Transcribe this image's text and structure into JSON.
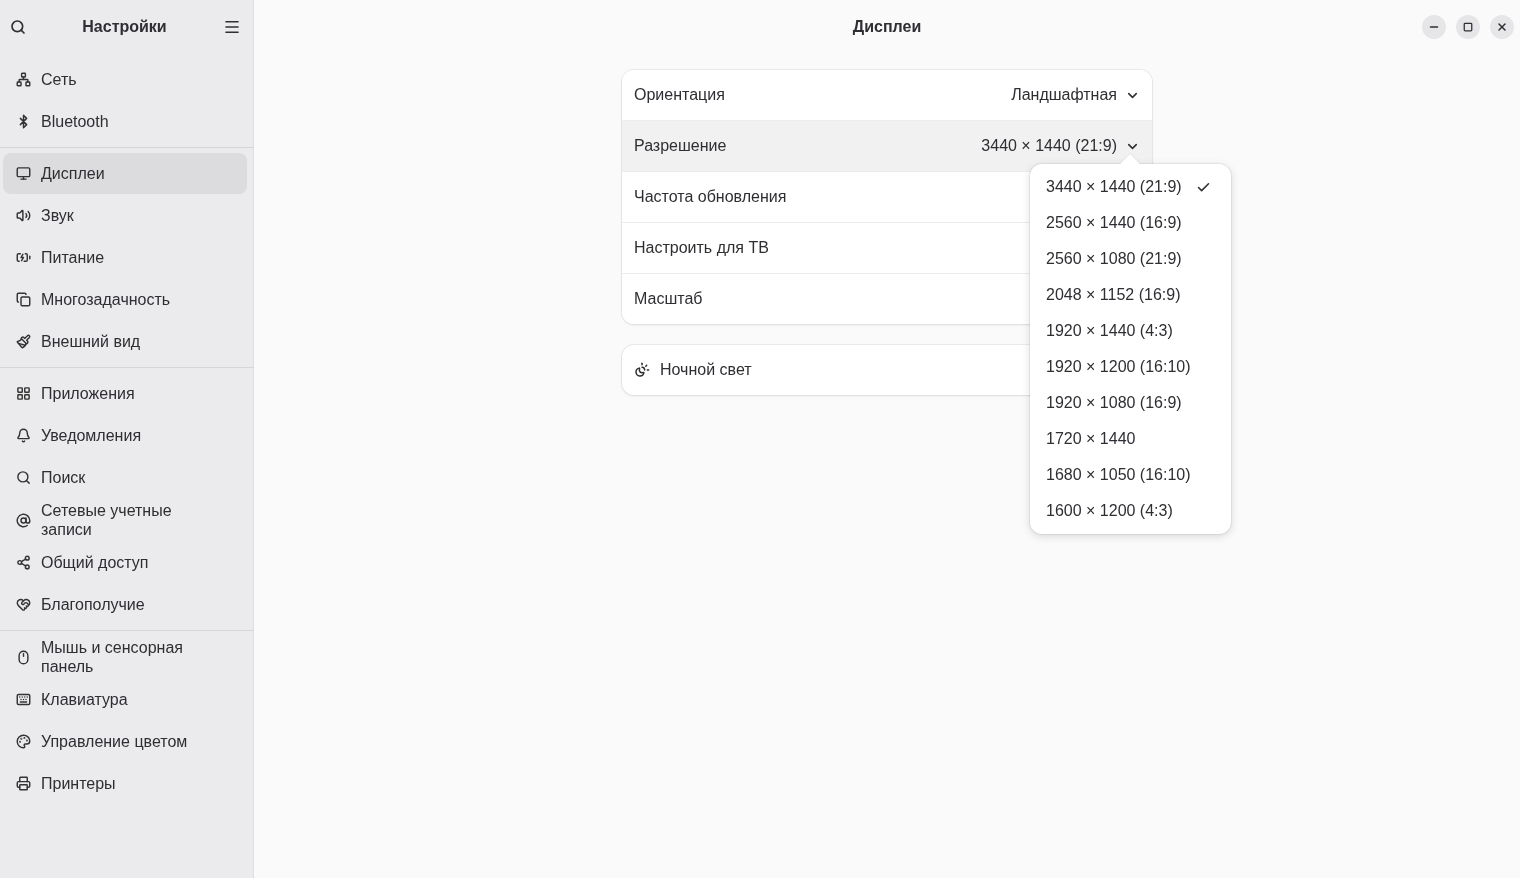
{
  "sidebar": {
    "title": "Настройки",
    "groups": [
      [
        {
          "label": "Сеть",
          "selected": false
        },
        {
          "label": "Bluetooth",
          "selected": false
        }
      ],
      [
        {
          "label": "Дисплеи",
          "selected": true
        },
        {
          "label": "Звук",
          "selected": false
        },
        {
          "label": "Питание",
          "selected": false
        },
        {
          "label": "Многозадачность",
          "selected": false
        },
        {
          "label": "Внешний вид",
          "selected": false
        }
      ],
      [
        {
          "label": "Приложения",
          "selected": false
        },
        {
          "label": "Уведомления",
          "selected": false
        },
        {
          "label": "Поиск",
          "selected": false
        },
        {
          "label": "Сетевые учетные записи",
          "selected": false
        },
        {
          "label": "Общий доступ",
          "selected": false
        },
        {
          "label": "Благополучие",
          "selected": false
        }
      ],
      [
        {
          "label": "Мышь и сенсорная панель",
          "selected": false
        },
        {
          "label": "Клавиатура",
          "selected": false
        },
        {
          "label": "Управление цветом",
          "selected": false
        },
        {
          "label": "Принтеры",
          "selected": false
        }
      ]
    ]
  },
  "page_title": "Дисплеи",
  "settings": [
    {
      "kind": "dropdown",
      "label": "Ориентация",
      "value": "Ландшафтная",
      "active": false
    },
    {
      "kind": "dropdown",
      "label": "Разрешение",
      "value": "3440 × 1440 (21:9)",
      "active": true
    },
    {
      "kind": "plain",
      "label": "Частота обновления",
      "active": false
    },
    {
      "kind": "plain",
      "label": "Настроить для ТВ",
      "active": false
    },
    {
      "kind": "plain",
      "label": "Масштаб",
      "active": false
    }
  ],
  "night_light": {
    "label": "Ночной свет"
  },
  "popover": {
    "options": [
      {
        "label": "3440 × 1440 (21:9)",
        "selected": true
      },
      {
        "label": "2560 × 1440 (16:9)",
        "selected": false
      },
      {
        "label": "2560 × 1080 (21:9)",
        "selected": false
      },
      {
        "label": "2048 × 1152 (16:9)",
        "selected": false
      },
      {
        "label": "1920 × 1440 (4:3)",
        "selected": false
      },
      {
        "label": "1920 × 1200 (16:10)",
        "selected": false
      },
      {
        "label": "1920 × 1080 (16:9)",
        "selected": false
      },
      {
        "label": "1720 × 1440",
        "selected": false
      },
      {
        "label": "1680 × 1050 (16:10)",
        "selected": false
      },
      {
        "label": "1600 × 1200 (4:3)",
        "selected": false
      }
    ]
  }
}
